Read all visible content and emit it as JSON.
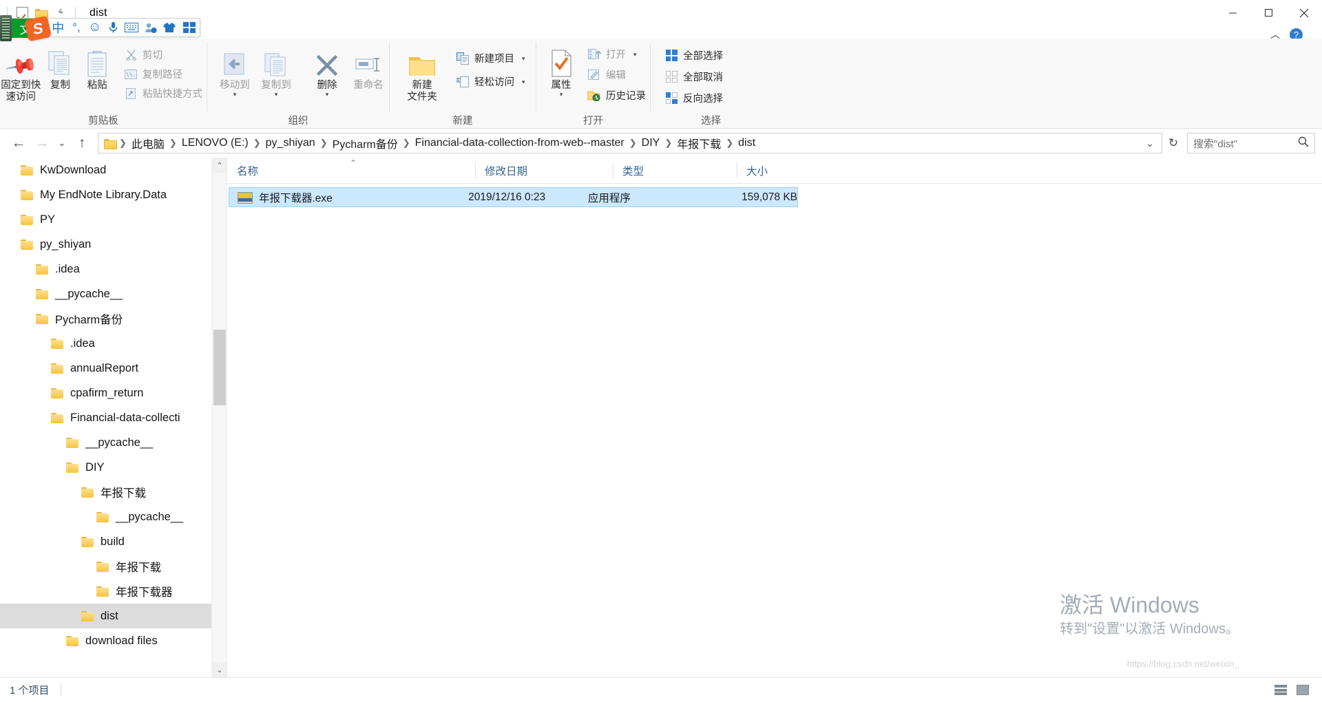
{
  "window": {
    "title": "dist",
    "quick_access": {
      "checkbox_icon": "checkbox-checked-icon",
      "folder_icon": "folder-icon",
      "dropdown_icon": "chevron-down-icon"
    },
    "controls": {
      "minimize": "minimize-icon",
      "restore": "restore-icon",
      "close": "close-icon",
      "ribbon_collapse": "chevron-up-icon",
      "help": "help-icon"
    }
  },
  "ime_toolbar": {
    "label": "文",
    "logo": "sogou-s-logo",
    "items": [
      {
        "name": "chinese-mode",
        "glyph": "中"
      },
      {
        "name": "punctuation-mode",
        "glyph": "°,"
      },
      {
        "name": "emoji",
        "glyph": "☺"
      },
      {
        "name": "voice-input",
        "glyph": "🎤"
      },
      {
        "name": "soft-keyboard",
        "glyph": "⌨"
      },
      {
        "name": "user-account",
        "glyph": "👤"
      },
      {
        "name": "skin",
        "glyph": "👕"
      },
      {
        "name": "toolbox",
        "glyph": "▦"
      }
    ]
  },
  "ribbon": {
    "groups": [
      {
        "label": "剪贴板",
        "big": [
          {
            "name": "pin-to-quick-access",
            "label": "固定到快\n速访问",
            "icon": "pin-icon",
            "dimmed": false
          },
          {
            "name": "copy",
            "label": "复制",
            "icon": "copy-icon",
            "dimmed": false
          },
          {
            "name": "paste",
            "label": "粘贴",
            "icon": "paste-icon",
            "dimmed": false
          }
        ],
        "small": [
          {
            "name": "cut",
            "label": "剪切",
            "icon": "scissors-icon",
            "dimmed": true
          },
          {
            "name": "copy-path",
            "label": "复制路径",
            "icon": "path-icon",
            "dimmed": true
          },
          {
            "name": "paste-shortcut",
            "label": "粘贴快捷方式",
            "icon": "shortcut-icon",
            "dimmed": true
          }
        ]
      },
      {
        "label": "组织",
        "big": [
          {
            "name": "move-to",
            "label": "移动到",
            "icon": "move-to-icon",
            "dimmed": true,
            "caret": true
          },
          {
            "name": "copy-to",
            "label": "复制到",
            "icon": "copy-to-icon",
            "dimmed": true,
            "caret": true
          },
          {
            "name": "delete",
            "label": "删除",
            "icon": "delete-x-icon",
            "dimmed": false,
            "caret": true
          },
          {
            "name": "rename",
            "label": "重命名",
            "icon": "rename-icon",
            "dimmed": true
          }
        ]
      },
      {
        "label": "新建",
        "big": [
          {
            "name": "new-folder",
            "label": "新建\n文件夹",
            "icon": "folder-icon",
            "dimmed": false
          }
        ],
        "small": [
          {
            "name": "new-item",
            "label": "新建项目",
            "icon": "new-item-icon",
            "caret": true,
            "dimmed": false
          },
          {
            "name": "easy-access",
            "label": "轻松访问",
            "icon": "easy-access-icon",
            "caret": true,
            "dimmed": false
          }
        ]
      },
      {
        "label": "打开",
        "big": [
          {
            "name": "properties",
            "label": "属性",
            "icon": "properties-icon",
            "dimmed": false,
            "caret": true
          }
        ],
        "small": [
          {
            "name": "open",
            "label": "打开",
            "icon": "open-icon",
            "caret": true,
            "dimmed": true
          },
          {
            "name": "edit",
            "label": "编辑",
            "icon": "edit-icon",
            "dimmed": true
          },
          {
            "name": "history",
            "label": "历史记录",
            "icon": "history-icon",
            "dimmed": false
          }
        ]
      },
      {
        "label": "选择",
        "small": [
          {
            "name": "select-all",
            "label": "全部选择",
            "icon": "select-all-icon",
            "dimmed": false
          },
          {
            "name": "select-none",
            "label": "全部取消",
            "icon": "select-none-icon",
            "dimmed": false
          },
          {
            "name": "invert-selection",
            "label": "反向选择",
            "icon": "invert-selection-icon",
            "dimmed": false
          }
        ]
      }
    ]
  },
  "address_bar": {
    "back_icon": "arrow-left-icon",
    "forward_icon": "arrow-right-icon",
    "recent_icon": "chevron-down-icon",
    "up_icon": "arrow-up-icon",
    "breadcrumb": [
      "此电脑",
      "LENOVO (E:)",
      "py_shiyan",
      "Pycharm备份",
      "Financial-data-collection-from-web--master",
      "DIY",
      "年报下载",
      "dist"
    ],
    "dropdown_icon": "chevron-down-icon",
    "refresh_icon": "refresh-icon",
    "search_placeholder": "搜索\"dist\"",
    "search_icon": "search-icon"
  },
  "nav_pane": {
    "items": [
      {
        "label": "KwDownload",
        "indent": 1
      },
      {
        "label": "My EndNote Library.Data",
        "indent": 1
      },
      {
        "label": "PY",
        "indent": 1
      },
      {
        "label": "py_shiyan",
        "indent": 1
      },
      {
        "label": ".idea",
        "indent": 2
      },
      {
        "label": "__pycache__",
        "indent": 2
      },
      {
        "label": "Pycharm备份",
        "indent": 2
      },
      {
        "label": ".idea",
        "indent": 3
      },
      {
        "label": "annualReport",
        "indent": 3
      },
      {
        "label": "cpafirm_return",
        "indent": 3
      },
      {
        "label": "Financial-data-collecti",
        "indent": 3
      },
      {
        "label": "__pycache__",
        "indent": 4
      },
      {
        "label": "DIY",
        "indent": 4
      },
      {
        "label": "年报下载",
        "indent": 5
      },
      {
        "label": "__pycache__",
        "indent": 6
      },
      {
        "label": "build",
        "indent": 5
      },
      {
        "label": "年报下载",
        "indent": 6
      },
      {
        "label": "年报下载器",
        "indent": 6
      },
      {
        "label": "dist",
        "indent": 5,
        "selected": true
      },
      {
        "label": "download files",
        "indent": 4
      }
    ],
    "scroll_up_icon": "chevron-up-icon",
    "scroll_down_icon": "chevron-down-icon"
  },
  "file_list": {
    "columns": [
      {
        "key": "name",
        "label": "名称"
      },
      {
        "key": "modified",
        "label": "修改日期"
      },
      {
        "key": "type",
        "label": "类型"
      },
      {
        "key": "size",
        "label": "大小"
      }
    ],
    "sort_indicator": "ascending-chevron-icon",
    "rows": [
      {
        "icon": "exe-file-icon",
        "name": "年报下载器.exe",
        "modified": "2019/12/16 0:23",
        "type": "应用程序",
        "size": "159,078 KB",
        "selected": true
      }
    ]
  },
  "status_bar": {
    "item_count": "1 个项目",
    "details_view_icon": "details-view-icon",
    "tiles_view_icon": "tiles-view-icon"
  },
  "watermark": {
    "line1": "激活 Windows",
    "line2": "转到\"设置\"以激活 Windows。",
    "credit": "https://blog.csdn.net/weixin_"
  },
  "colors": {
    "selection": "#cce8ff",
    "header_text": "#35658f",
    "folder": "#f5c43f",
    "accent_orange": "#e2702a"
  }
}
